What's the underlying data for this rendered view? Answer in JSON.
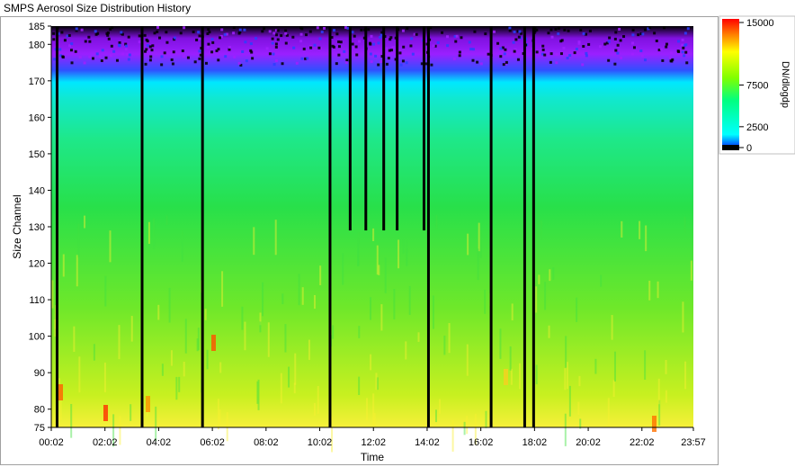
{
  "window": {
    "title": "SMPS Aerosol Size Distribution History"
  },
  "colors": {
    "background": "#000000",
    "gap_lines": "#000000",
    "colormap": [
      "#000000",
      "#0000ff",
      "#00ffff",
      "#00ff80",
      "#80ff00",
      "#ffff00",
      "#ff8000",
      "#ff0000"
    ]
  },
  "chart_data": {
    "type": "heatmap",
    "title": "",
    "xlabel": "Time",
    "ylabel": "Size Channel",
    "x_ticks": [
      "00:02",
      "02:02",
      "04:02",
      "06:02",
      "08:02",
      "10:02",
      "12:02",
      "14:02",
      "16:02",
      "18:02",
      "20:02",
      "22:02",
      "23:57"
    ],
    "x_range": [
      "00:02",
      "23:57"
    ],
    "y_ticks": [
      75,
      80,
      90,
      100,
      110,
      120,
      130,
      140,
      150,
      160,
      170,
      180,
      185
    ],
    "ylim": [
      75,
      185
    ],
    "colorbar": {
      "label": "DN/dlogdp",
      "ticks": [
        0,
        2500,
        7500,
        15000
      ],
      "range": [
        0,
        15000
      ]
    },
    "levels_by_channel": [
      {
        "channel_range": [
          170,
          185
        ],
        "value": "≈0–1000 (blue/purple, sparse)"
      },
      {
        "channel_range": [
          160,
          170
        ],
        "value": "≈2000–3000"
      },
      {
        "channel_range": [
          130,
          160
        ],
        "value": "≈4000–5500"
      },
      {
        "channel_range": [
          75,
          130
        ],
        "value": "≈5000–8000, local peaks ≈12000 near channels 75–85"
      }
    ],
    "gaps": [
      {
        "time": "00:15",
        "channel_range": [
          75,
          185
        ]
      },
      {
        "time": "03:25",
        "channel_range": [
          75,
          185
        ]
      },
      {
        "time": "05:40",
        "channel_range": [
          75,
          185
        ]
      },
      {
        "time": "10:25",
        "channel_range": [
          75,
          185
        ]
      },
      {
        "time": "11:10",
        "channel_range": [
          129,
          185
        ]
      },
      {
        "time": "11:45",
        "channel_range": [
          129,
          185
        ]
      },
      {
        "time": "12:25",
        "channel_range": [
          129,
          185
        ]
      },
      {
        "time": "12:55",
        "channel_range": [
          129,
          185
        ]
      },
      {
        "time": "13:55",
        "channel_range": [
          129,
          185
        ]
      },
      {
        "time": "14:05",
        "channel_range": [
          75,
          185
        ]
      },
      {
        "time": "16:25",
        "channel_range": [
          75,
          185
        ]
      },
      {
        "time": "17:40",
        "channel_range": [
          75,
          185
        ]
      },
      {
        "time": "18:00",
        "channel_range": [
          75,
          185
        ]
      }
    ]
  }
}
